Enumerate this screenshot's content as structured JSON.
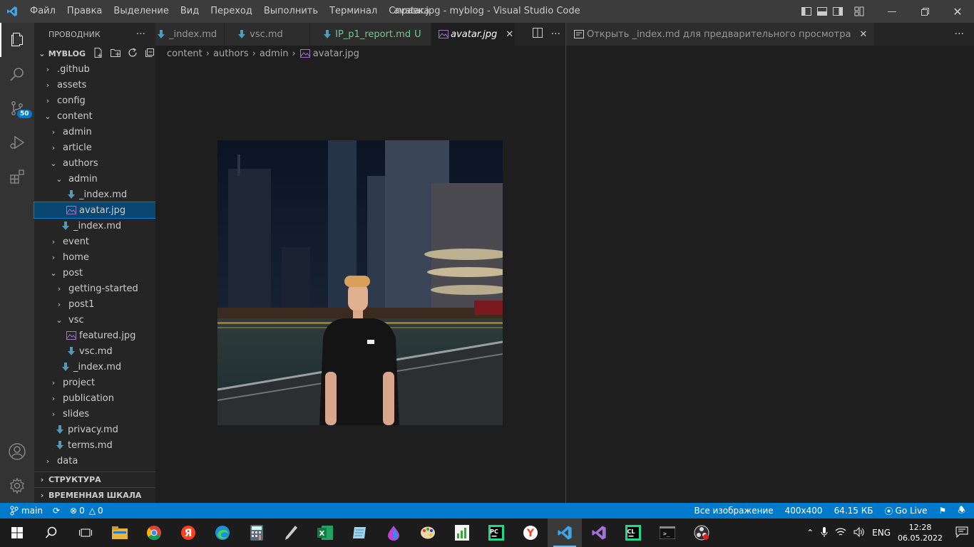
{
  "window": {
    "title": "avatar.jpg - myblog - Visual Studio Code",
    "menu": [
      "Файл",
      "Правка",
      "Выделение",
      "Вид",
      "Переход",
      "Выполнить",
      "Терминал",
      "Справка"
    ]
  },
  "activity": {
    "scm_badge": "50"
  },
  "explorer": {
    "header": "ПРОВОДНИК",
    "root": "MYBLOG",
    "tree": [
      {
        "label": ".github",
        "depth": 0,
        "type": "folder",
        "open": false
      },
      {
        "label": "assets",
        "depth": 0,
        "type": "folder",
        "open": false
      },
      {
        "label": "config",
        "depth": 0,
        "type": "folder",
        "open": false
      },
      {
        "label": "content",
        "depth": 0,
        "type": "folder",
        "open": true
      },
      {
        "label": "admin",
        "depth": 1,
        "type": "folder",
        "open": false
      },
      {
        "label": "article",
        "depth": 1,
        "type": "folder",
        "open": false
      },
      {
        "label": "authors",
        "depth": 1,
        "type": "folder",
        "open": true
      },
      {
        "label": "admin",
        "depth": 2,
        "type": "folder",
        "open": true
      },
      {
        "label": "_index.md",
        "depth": 3,
        "type": "md"
      },
      {
        "label": "avatar.jpg",
        "depth": 3,
        "type": "img",
        "selected": true
      },
      {
        "label": "_index.md",
        "depth": 2,
        "type": "md"
      },
      {
        "label": "event",
        "depth": 1,
        "type": "folder",
        "open": false
      },
      {
        "label": "home",
        "depth": 1,
        "type": "folder",
        "open": false
      },
      {
        "label": "post",
        "depth": 1,
        "type": "folder",
        "open": true
      },
      {
        "label": "getting-started",
        "depth": 2,
        "type": "folder",
        "open": false
      },
      {
        "label": "post1",
        "depth": 2,
        "type": "folder",
        "open": false
      },
      {
        "label": "vsc",
        "depth": 2,
        "type": "folder",
        "open": true
      },
      {
        "label": "featured.jpg",
        "depth": 3,
        "type": "img"
      },
      {
        "label": "vsc.md",
        "depth": 3,
        "type": "md"
      },
      {
        "label": "_index.md",
        "depth": 2,
        "type": "md"
      },
      {
        "label": "project",
        "depth": 1,
        "type": "folder",
        "open": false
      },
      {
        "label": "publication",
        "depth": 1,
        "type": "folder",
        "open": false
      },
      {
        "label": "slides",
        "depth": 1,
        "type": "folder",
        "open": false
      },
      {
        "label": "privacy.md",
        "depth": 1,
        "type": "md"
      },
      {
        "label": "terms.md",
        "depth": 1,
        "type": "md"
      },
      {
        "label": "data",
        "depth": 0,
        "type": "folder",
        "open": false
      }
    ],
    "sections": [
      "СТРУКТУРА",
      "ВРЕМЕННАЯ ШКАЛА"
    ]
  },
  "editor": {
    "tabs": [
      {
        "label": "_index.md",
        "kind": "md"
      },
      {
        "label": "vsc.md",
        "kind": "md"
      },
      {
        "label": "IP_p1_report.md",
        "suffix": "U",
        "kind": "md-git"
      },
      {
        "label": "avatar.jpg",
        "kind": "img",
        "active": true
      }
    ],
    "breadcrumb": [
      "content",
      "authors",
      "admin",
      "avatar.jpg"
    ],
    "preview_tab": "Открыть _index.md для предварительного просмотра"
  },
  "status": {
    "branch": "main",
    "errors": "0",
    "warnings": "0",
    "zoom": "Все изображение",
    "dims": "400x400",
    "size": "64.15 КБ",
    "golive": "Go Live"
  },
  "taskbar": {
    "lang": "ENG",
    "time": "12:28",
    "date": "06.05.2022"
  },
  "colors": {
    "accent": "#007acc",
    "git_untracked": "#73c991",
    "md_icon": "#519aba",
    "img_icon": "#a074c4"
  }
}
